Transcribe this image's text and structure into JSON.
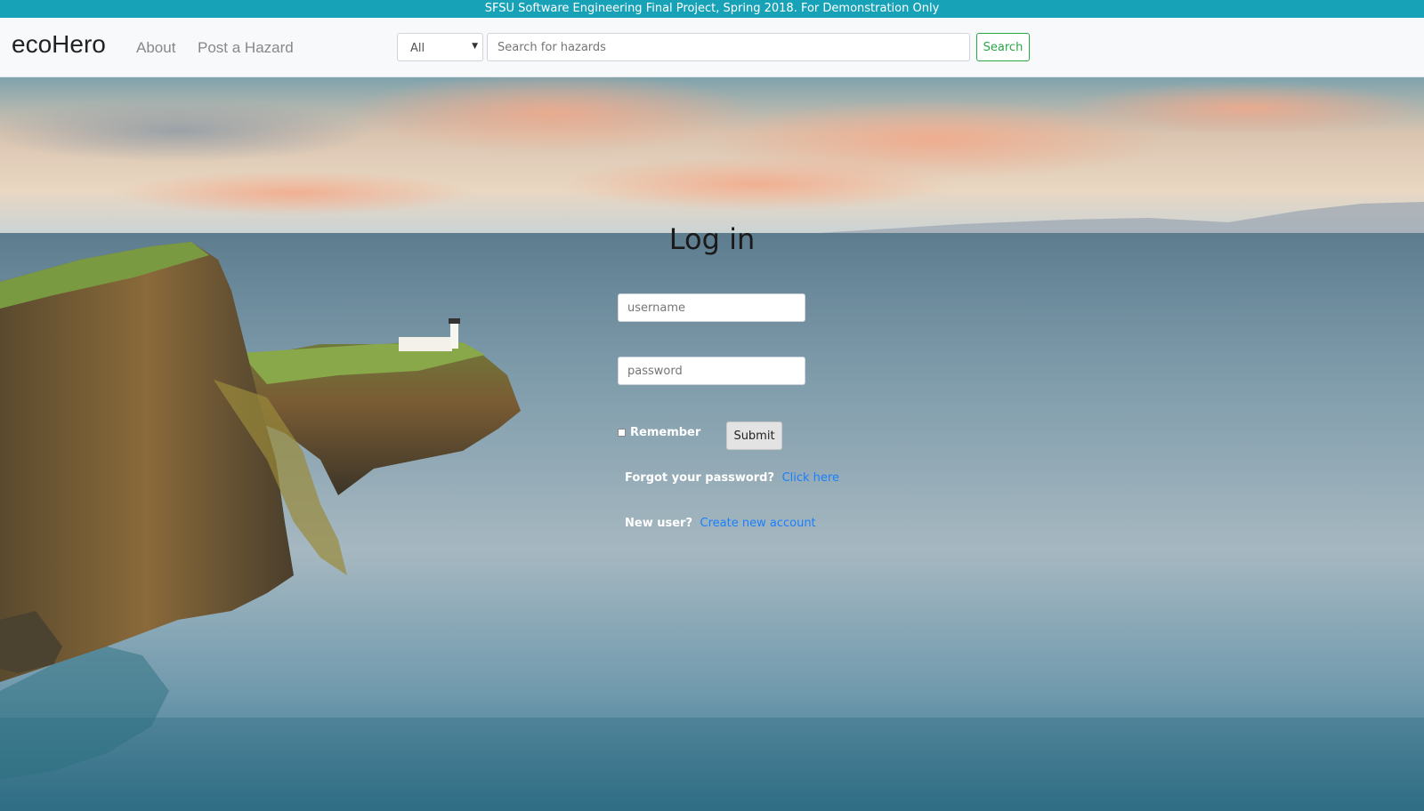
{
  "banner": {
    "text": "SFSU Software Engineering Final Project, Spring 2018. For Demonstration Only"
  },
  "navbar": {
    "brand": "ecoHero",
    "links": [
      "About",
      "Post a Hazard"
    ],
    "search": {
      "category_selected": "All",
      "placeholder": "Search for hazards",
      "button_label": "Search"
    }
  },
  "login": {
    "title": "Log in",
    "username_placeholder": "username",
    "password_placeholder": "password",
    "remember_label": "Remember",
    "submit_label": "Submit",
    "forgot_text": "Forgot your password?",
    "forgot_link": "Click here",
    "new_user_text": "New user?",
    "new_user_link": "Create new account"
  },
  "colors": {
    "banner": "#17a2b8",
    "search_button": "#28a745",
    "link": "#1a7fff"
  },
  "icons": {
    "select_caret": "chevron-down-icon"
  }
}
